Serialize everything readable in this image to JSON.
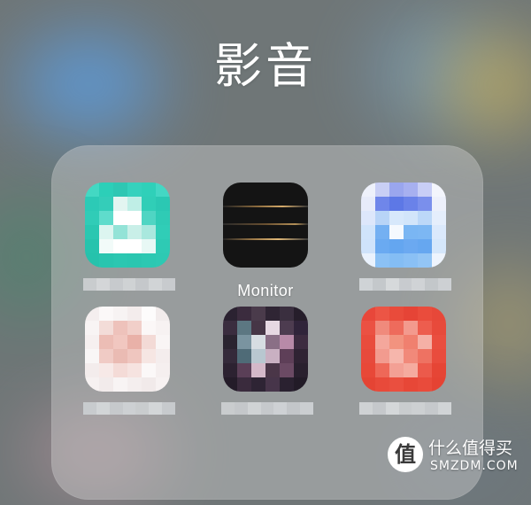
{
  "folder": {
    "title": "影音"
  },
  "apps": [
    {
      "label": "",
      "icon": "pixelated-teal-app-icon"
    },
    {
      "label": "Monitor",
      "icon": "monitor-app-icon"
    },
    {
      "label": "",
      "icon": "pixelated-blue-app-icon"
    },
    {
      "label": "",
      "icon": "pixelated-pink-app-icon"
    },
    {
      "label": "",
      "icon": "pixelated-dark-app-icon"
    },
    {
      "label": "",
      "icon": "pixelated-red-app-icon"
    }
  ],
  "watermark": {
    "badge": "值",
    "text_cn": "什么值得买",
    "text_en": "SMZDM.COM"
  },
  "colors": {
    "teal": "#2fd3bd",
    "blue": "#6f9ef0",
    "pink": "#f1c9c4",
    "dark": "#3a2e3c",
    "red": "#ea4b3a",
    "monitor_line": "#c9a063"
  }
}
